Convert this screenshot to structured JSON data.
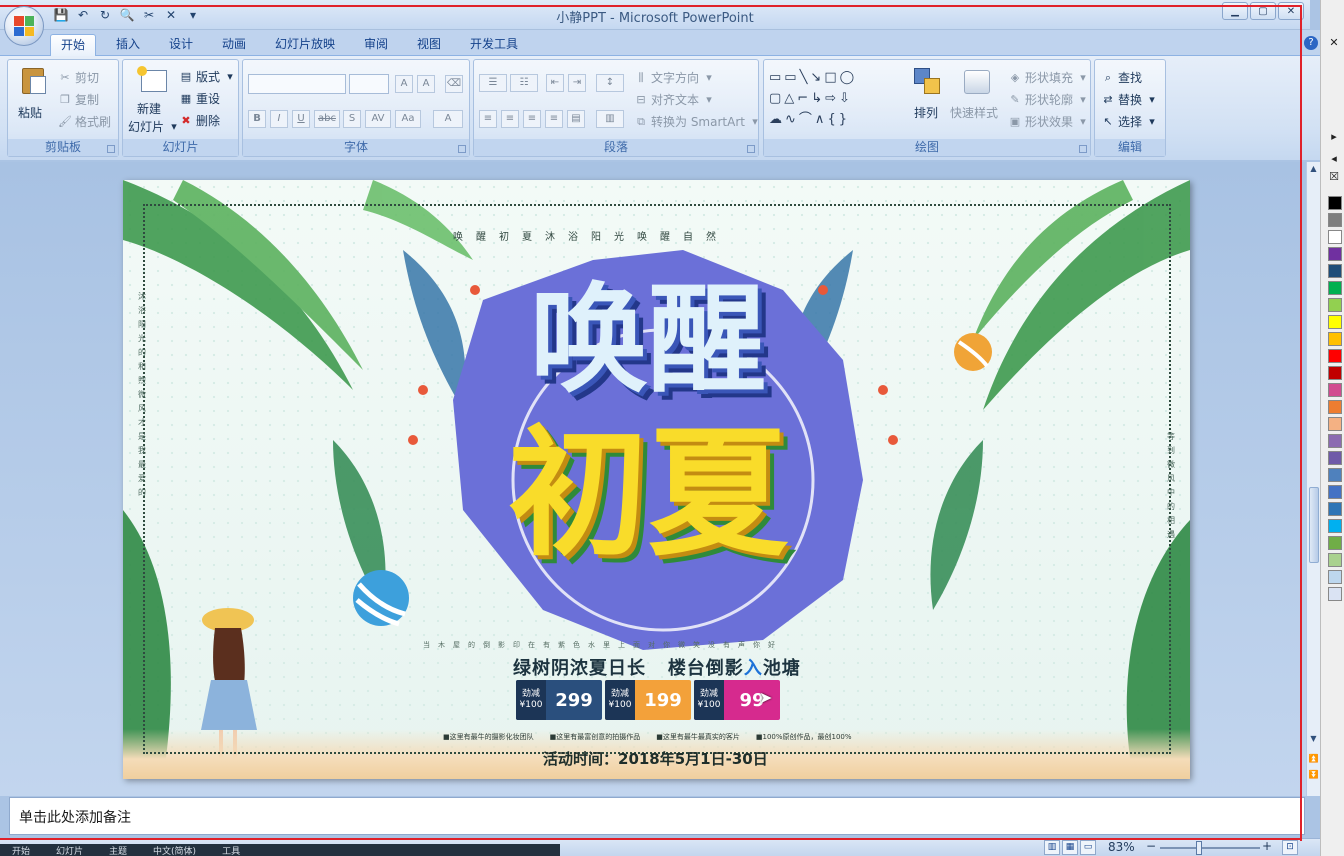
{
  "window": {
    "title": "小静PPT - Microsoft PowerPoint",
    "controls": {
      "min": "▁",
      "max": "▢",
      "close": "✕"
    }
  },
  "qat": [
    "save-icon",
    "undo-icon",
    "redo-icon",
    "print-preview-icon",
    "cut-icon",
    "close-icon",
    "dropdown-icon"
  ],
  "tabs": [
    {
      "label": "开始",
      "active": true
    },
    {
      "label": "插入"
    },
    {
      "label": "设计"
    },
    {
      "label": "动画"
    },
    {
      "label": "幻灯片放映"
    },
    {
      "label": "审阅"
    },
    {
      "label": "视图"
    },
    {
      "label": "开发工具"
    }
  ],
  "ribbon": {
    "clipboard": {
      "label": "剪贴板",
      "paste": "粘贴",
      "cut": "剪切",
      "copy": "复制",
      "format_painter": "格式刷"
    },
    "slides": {
      "label": "幻灯片",
      "new_slide_1": "新建",
      "new_slide_2": "幻灯片",
      "layout": "版式",
      "reset": "重设",
      "delete": "删除"
    },
    "font": {
      "label": "字体",
      "bold": "B",
      "italic": "I",
      "underline": "U",
      "strike": "abc",
      "shadow": "S",
      "spacing": "AV",
      "case": "Aa",
      "color": "A",
      "grow": "A",
      "shrink": "A"
    },
    "paragraph": {
      "label": "段落",
      "text_direction": "文字方向",
      "align_text": "对齐文本",
      "smartart": "转换为 SmartArt"
    },
    "drawing": {
      "label": "绘图",
      "arrange": "排列",
      "quick_styles": "快速样式",
      "fill": "形状填充",
      "outline": "形状轮廓",
      "effects": "形状效果"
    },
    "editing": {
      "label": "编辑",
      "find": "查找",
      "replace": "替换",
      "select": "选择"
    }
  },
  "slide": {
    "top_text": "唤醒初夏沐浴阳光唤醒自然",
    "left_text": "沐浴阳光的和煦微风才是我最爱的",
    "right_text": "等到微风中的相遇",
    "title_line1": "唤醒",
    "title_line2": "初夏",
    "subline": "当木屋的倒影印在有紫色水里上面对你微笑没有声你好",
    "slogan_a": "绿树阴浓夏日长",
    "slogan_b1": "楼台倒影",
    "slogan_b2": "入",
    "slogan_b3": "池塘",
    "prices": [
      {
        "tag1": "劲减",
        "tag2": "¥100",
        "value": "299",
        "color": "#2a4f7d"
      },
      {
        "tag1": "劲减",
        "tag2": "¥100",
        "value": "199",
        "color": "#f3a13a"
      },
      {
        "tag1": "劲减",
        "tag2": "¥100",
        "value": "99",
        "color": "#d62a8e"
      }
    ],
    "notes": [
      "■这里有最牛的摄影化妆团队",
      "■这里有最富创意的拍摄作品",
      "■这里有最牛最真实的客片",
      "■100%原创作品，最创100%"
    ],
    "date": "活动时间：2018年5月1日-30日"
  },
  "notes_placeholder": "单击此处添加备注",
  "status": {
    "zoom": "83%",
    "minus": "−",
    "plus": "+"
  },
  "taskbar": [
    "开始",
    "幻灯片",
    "主题",
    "中文(简体)",
    "工具"
  ],
  "palette_colors": [
    "#000000",
    "#7f7f7f",
    "#ffffff",
    "#7030a0",
    "#1f4e79",
    "#00b050",
    "#92d050",
    "#ffff00",
    "#ffc000",
    "#ff0000",
    "#c00000",
    "#d14b8f",
    "#ed7d31",
    "#f4b183",
    "#8b6bb1",
    "#6f5aa8",
    "#4f81bd",
    "#4472c4",
    "#2e75b6",
    "#00b0f0",
    "#70ad47",
    "#a9d18e",
    "#bdd7ee",
    "#dae3f3"
  ]
}
